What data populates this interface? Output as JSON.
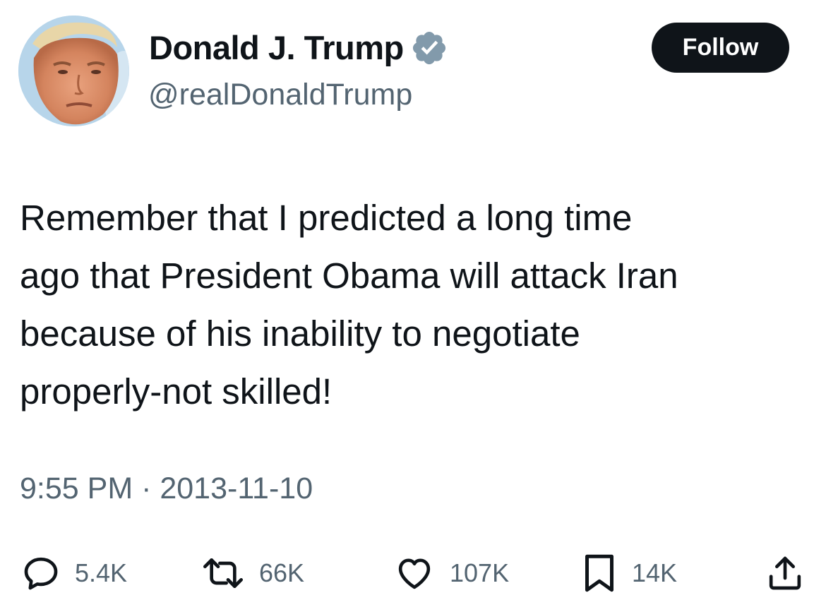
{
  "tweet": {
    "author": {
      "display_name": "Donald J. Trump",
      "handle": "@realDonaldTrump",
      "verified_icon": "verified-badge-icon",
      "badge_color": "#829aab"
    },
    "follow_label": "Follow",
    "text_lines": [
      "Remember that I predicted a long time",
      "ago that President Obama will attack Iran",
      "because of his inability to negotiate",
      "properly-not skilled!"
    ],
    "timestamp": "9:55 PM · 2013-11-10",
    "metrics": {
      "replies": "5.4K",
      "reposts": "66K",
      "likes": "107K",
      "bookmarks": "14K"
    },
    "icons": {
      "reply": "reply-icon",
      "repost": "repost-icon",
      "like": "heart-icon",
      "bookmark": "bookmark-icon",
      "share": "share-icon"
    }
  },
  "colors": {
    "text_primary": "#0f1419",
    "text_secondary": "#536471",
    "button_bg": "#0f1419",
    "button_text": "#ffffff"
  }
}
